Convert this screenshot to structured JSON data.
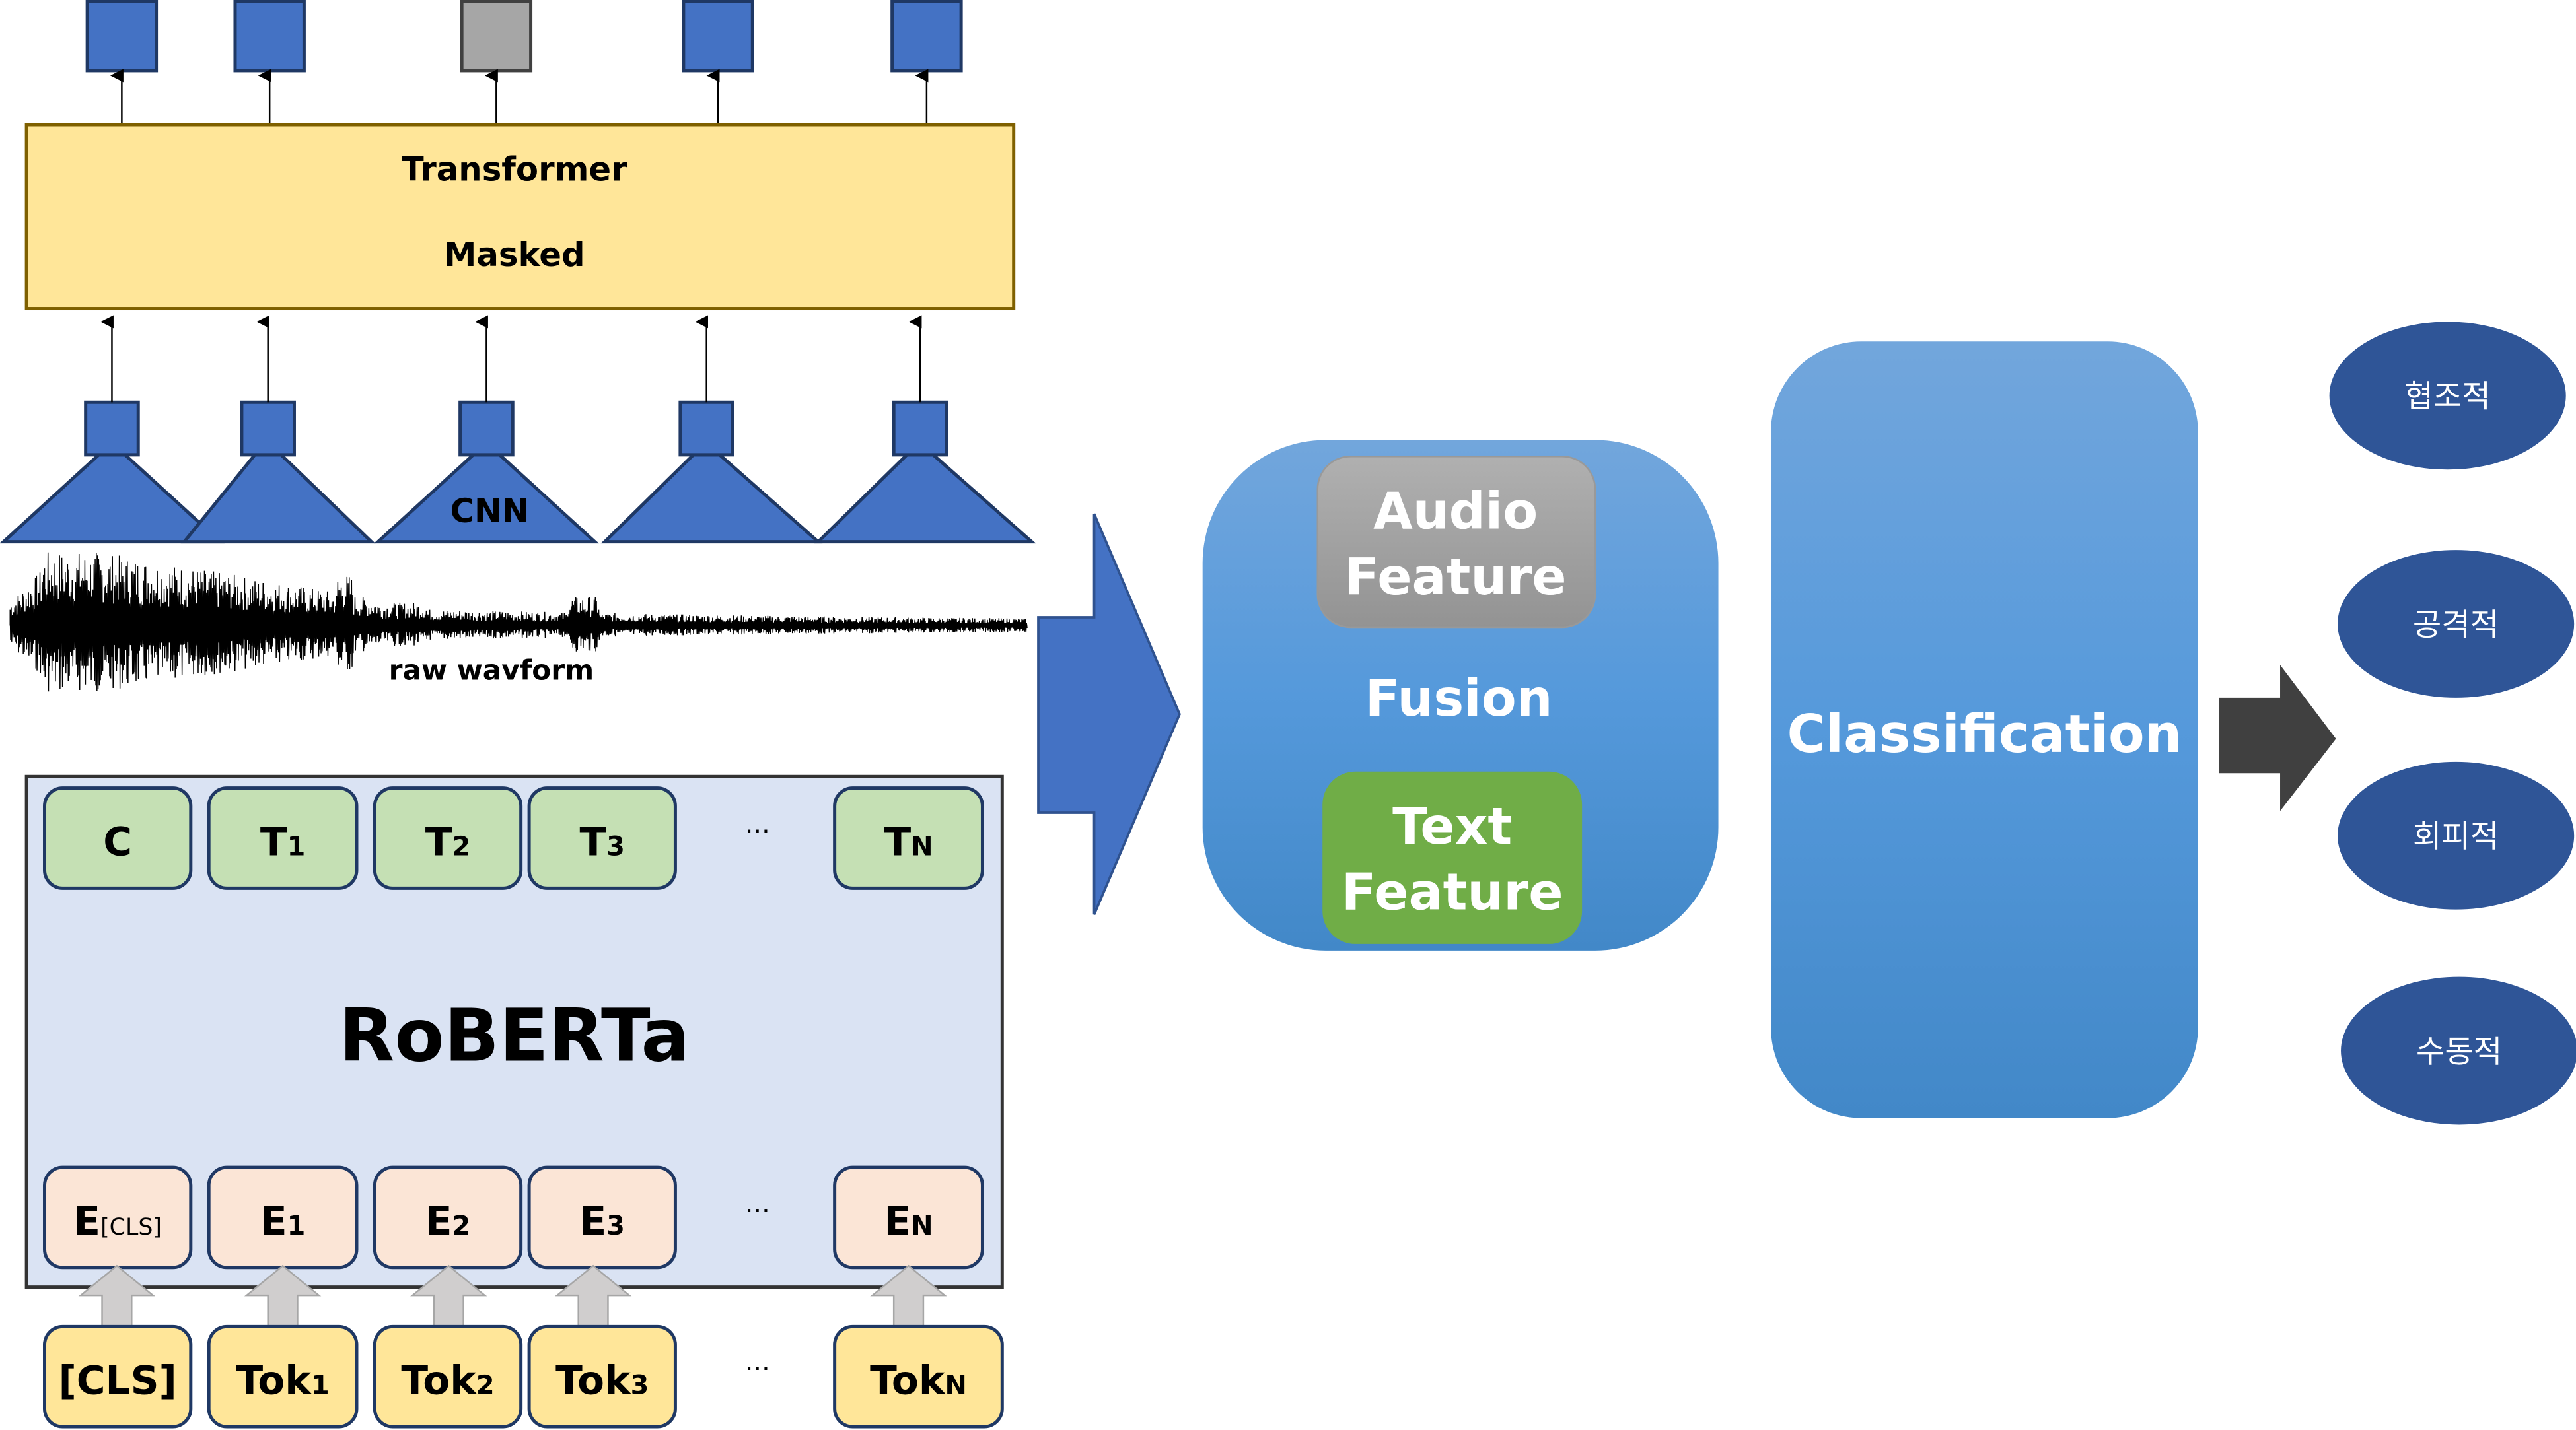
{
  "audio_branch": {
    "transformer_title": "Transformer",
    "transformer_subtitle": "Masked",
    "cnn_label": "CNN",
    "waveform_label": "raw wavform",
    "outputs": [
      {
        "masked": false
      },
      {
        "masked": false
      },
      {
        "masked": true
      },
      {
        "masked": false
      },
      {
        "masked": false
      }
    ]
  },
  "text_branch": {
    "model_label": "RoBERTa",
    "ellipsis": "···",
    "outputs": [
      {
        "main": "C",
        "sub": ""
      },
      {
        "main": "T",
        "sub": "1"
      },
      {
        "main": "T",
        "sub": "2"
      },
      {
        "main": "T",
        "sub": "3"
      },
      {
        "main": "T",
        "sub": "N"
      }
    ],
    "embeddings": [
      {
        "main": "E",
        "sub": "[CLS]"
      },
      {
        "main": "E",
        "sub": "1"
      },
      {
        "main": "E",
        "sub": "2"
      },
      {
        "main": "E",
        "sub": "3"
      },
      {
        "main": "E",
        "sub": "N"
      }
    ],
    "tokens": [
      {
        "main": "[CLS]",
        "sub": ""
      },
      {
        "main": "Tok",
        "sub": "1"
      },
      {
        "main": "Tok",
        "sub": "2"
      },
      {
        "main": "Tok",
        "sub": "3"
      },
      {
        "main": "Tok",
        "sub": "N"
      }
    ]
  },
  "fusion": {
    "audio_feature": [
      "Audio",
      "Feature"
    ],
    "label": "Fusion",
    "text_feature": [
      "Text",
      "Feature"
    ]
  },
  "classification": {
    "label": "Classification"
  },
  "classes": [
    "협조적",
    "공격적",
    "회피적",
    "수동적"
  ],
  "colors": {
    "blue": "#4472c4",
    "gray_masked": "#a6a6a6",
    "transformer_fill": "#ffe699",
    "roberta_fill": "#dae3f3",
    "output_fill": "#c5e0b4",
    "embedding_fill": "#fbe5d6",
    "token_fill": "#ffe699",
    "audio_feature": "#a6a6a6",
    "text_feature": "#70ad47",
    "class_ellipse": "#2f5597",
    "dark_arrow": "#404040"
  }
}
